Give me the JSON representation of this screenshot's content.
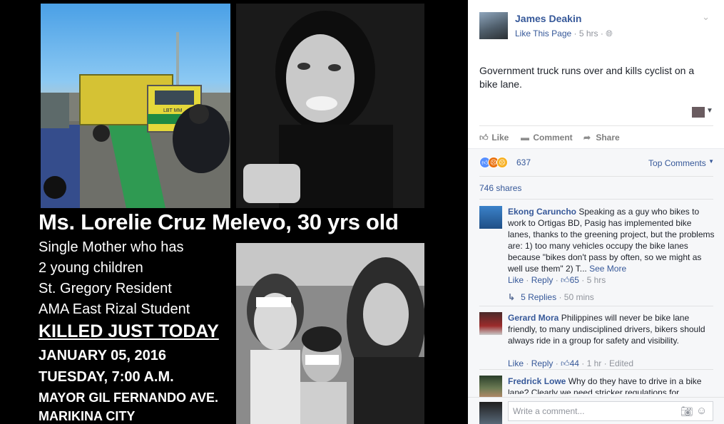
{
  "photo": {
    "name_line": "Ms. Lorelie Cruz Melevo, 30 yrs old",
    "lines": [
      "Single Mother who has",
      "2 young children",
      "St. Gregory Resident",
      "AMA East Rizal Student"
    ],
    "killed": "KILLED JUST TODAY",
    "date": "JANUARY 05, 2016",
    "day_time": "TUESDAY, 7:00 A.M.",
    "avenue": "MAYOR GIL FERNANDO AVE.",
    "city": "MARIKINA CITY",
    "truck_label": "LBT MM"
  },
  "post": {
    "author": "James Deakin",
    "like_page": "Like This Page",
    "time": "5 hrs",
    "text": "Government truck runs over and kills cyclist on a bike lane."
  },
  "actions": {
    "like": "Like",
    "comment": "Comment",
    "share": "Share"
  },
  "reactions": {
    "count": "637",
    "top_comments": "Top Comments"
  },
  "shares": "746 shares",
  "comments": [
    {
      "name": "Ekong Caruncho",
      "text": "Speaking as a guy who bikes to work to Ortigas BD, Pasig has implemented bike lanes, thanks to the greening project, but the problems are: 1) too many vehicles occupy the bike lanes because \"bikes don't pass by often, so we might as well use them\" 2) T...",
      "see_more": "See More",
      "like": "Like",
      "reply": "Reply",
      "likes": "65",
      "time": "5 hrs",
      "replies": "5 Replies",
      "replies_time": "50 mins"
    },
    {
      "name": "Gerard Mora",
      "text": "Philippines will never be bike lane friendly, to many undisciplined drivers, bikers should always ride in a group for safety and visibility.",
      "like": "Like",
      "reply": "Reply",
      "likes": "44",
      "time": "1 hr",
      "edited": "Edited"
    },
    {
      "name": "Fredrick Lowe",
      "text": "Why do they have to drive in a bike lane? Clearly we need stricker regulations for"
    }
  ],
  "write": {
    "placeholder": "Write a comment..."
  },
  "icons": {
    "chevron": "chevron-down-icon",
    "globe": "globe-icon",
    "camera": "camera-icon",
    "emoji": "emoji-icon"
  }
}
